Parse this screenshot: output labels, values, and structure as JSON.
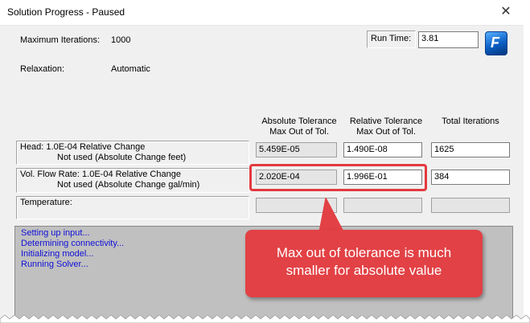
{
  "window": {
    "title": "Solution Progress - Paused",
    "close_glyph": "✕"
  },
  "summary": {
    "max_iterations_label": "Maximum Iterations:",
    "max_iterations_value": "1000",
    "relaxation_label": "Relaxation:",
    "relaxation_value": "Automatic",
    "run_time_label": "Run Time:",
    "run_time_value": "3.81",
    "logo_letter": "F",
    "logo_icon": "app-logo-icon"
  },
  "table": {
    "col_abs_line1": "Absolute Tolerance",
    "col_abs_line2": "Max Out of Tol.",
    "col_rel_line1": "Relative Tolerance",
    "col_rel_line2": "Max Out of Tol.",
    "col_total": "Total Iterations",
    "rows": [
      {
        "label_line1": "Head: 1.0E-04 Relative Change",
        "label_line2": "Not used (Absolute Change feet)",
        "abs": "5.459E-05",
        "rel": "1.490E-08",
        "total": "1625"
      },
      {
        "label_line1": "Vol. Flow Rate: 1.0E-04 Relative Change",
        "label_line2": "Not used (Absolute Change gal/min)",
        "abs": "2.020E-04",
        "rel": "1.996E-01",
        "total": "384"
      },
      {
        "label_line1": "Temperature:",
        "label_line2": "",
        "abs": "",
        "rel": "",
        "total": ""
      }
    ]
  },
  "log": {
    "lines": [
      "Setting up input...",
      "Determining connectivity...",
      "Initializing model...",
      "Running Solver..."
    ]
  },
  "annotation": {
    "line1": "Max out of tolerance is much",
    "line2": "smaller for absolute value",
    "color": "#e24145"
  }
}
